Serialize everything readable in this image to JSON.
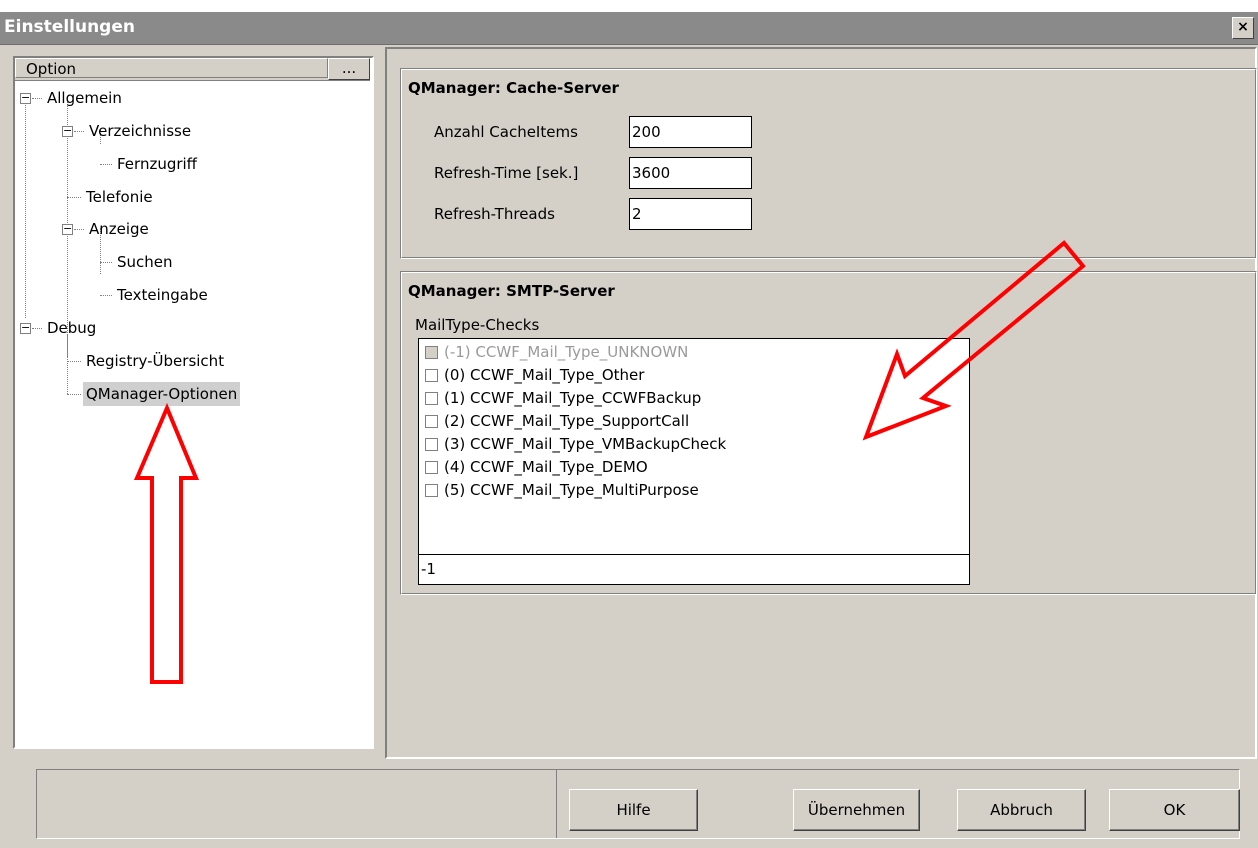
{
  "window": {
    "title": "Einstellungen",
    "close_label": "×"
  },
  "tree": {
    "header_label": "Option",
    "header_more": "...",
    "nodes": [
      {
        "label": "Allgemein",
        "level": 0,
        "expander": "⊟"
      },
      {
        "label": "Verzeichnisse",
        "level": 1,
        "expander": "⊟"
      },
      {
        "label": "Fernzugriff",
        "level": 2
      },
      {
        "label": "Telefonie",
        "level": 1
      },
      {
        "label": "Anzeige",
        "level": 1,
        "expander": "⊟"
      },
      {
        "label": "Suchen",
        "level": 2
      },
      {
        "label": "Texteingabe",
        "level": 2
      },
      {
        "label": "Debug",
        "level": 0,
        "expander": "⊟"
      },
      {
        "label": "Registry-Übersicht",
        "level": 1
      },
      {
        "label": "QManager-Optionen",
        "level": 1,
        "selected": true
      }
    ]
  },
  "cache_server": {
    "title": "QManager: Cache-Server",
    "fields": [
      {
        "label": "Anzahl CacheItems",
        "value": "200"
      },
      {
        "label": "Refresh-Time [sek.]",
        "value": "3600"
      },
      {
        "label": "Refresh-Threads",
        "value": "2"
      }
    ]
  },
  "smtp_server": {
    "title": "QManager: SMTP-Server",
    "list_label": "MailType-Checks",
    "items": [
      {
        "label": "(-1) CCWF_Mail_Type_UNKNOWN",
        "disabled": true
      },
      {
        "label": "(0) CCWF_Mail_Type_Other"
      },
      {
        "label": "(1) CCWF_Mail_Type_CCWFBackup"
      },
      {
        "label": "(2) CCWF_Mail_Type_SupportCall"
      },
      {
        "label": "(3) CCWF_Mail_Type_VMBackupCheck"
      },
      {
        "label": "(4) CCWF_Mail_Type_DEMO"
      },
      {
        "label": "(5) CCWF_Mail_Type_MultiPurpose"
      }
    ],
    "value_field": "-1"
  },
  "buttons": {
    "help": "Hilfe",
    "apply": "Übernehmen",
    "cancel": "Abbruch",
    "ok": "OK"
  },
  "colors": {
    "annotation_arrow": "#ff0000",
    "titlebar": "#8a8a8a",
    "dialog_bg": "#d4d0c8"
  }
}
